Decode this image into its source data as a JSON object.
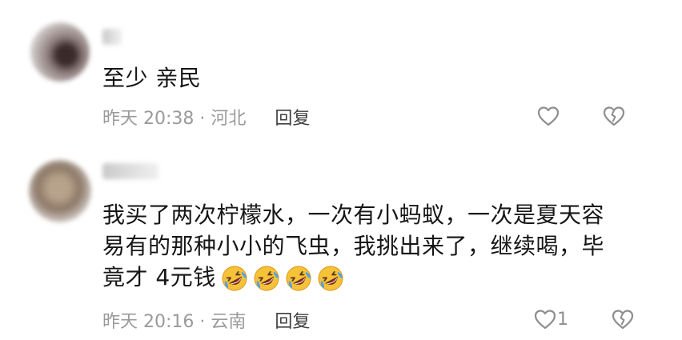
{
  "comments": [
    {
      "text": "至少 亲民",
      "time_location": "昨天 20:38 · 河北",
      "reply_label": "回复",
      "like_count": ""
    },
    {
      "text": "我买了两次柠檬水，一次有小蚂蚁，一次是夏天容\n易有的那种小小的飞虫，我挑出来了，继续喝，毕\n竟才 4元钱",
      "emoji_name": "rolling-laughing-emoji",
      "emoji_count": 4,
      "time_location": "昨天 20:16 · 云南",
      "reply_label": "回复",
      "like_count": "1"
    }
  ],
  "colors": {
    "meta": "#9a9a9a",
    "text": "#161616",
    "icon": "#8e8e8e",
    "emoji_face": "#f6c23a"
  }
}
